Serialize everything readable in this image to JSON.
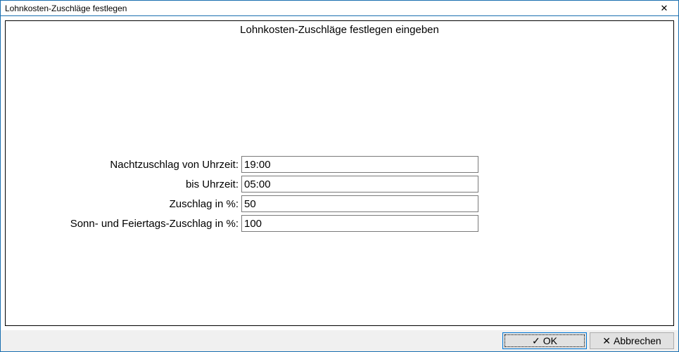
{
  "window": {
    "title": "Lohnkosten-Zuschläge festlegen"
  },
  "heading": "Lohnkosten-Zuschläge festlegen eingeben",
  "form": {
    "night_from_label": "Nachtzuschlag von Uhrzeit:",
    "night_from_value": "19:00",
    "night_to_label": "bis Uhrzeit:",
    "night_to_value": "05:00",
    "percent_label": "Zuschlag in %:",
    "percent_value": "50",
    "holiday_label": "Sonn- und Feiertags-Zuschlag in %:",
    "holiday_value": "100"
  },
  "buttons": {
    "ok": "OK",
    "cancel": "Abbrechen"
  },
  "glyphs": {
    "check": "✓",
    "cross": "✕",
    "close": "✕"
  }
}
